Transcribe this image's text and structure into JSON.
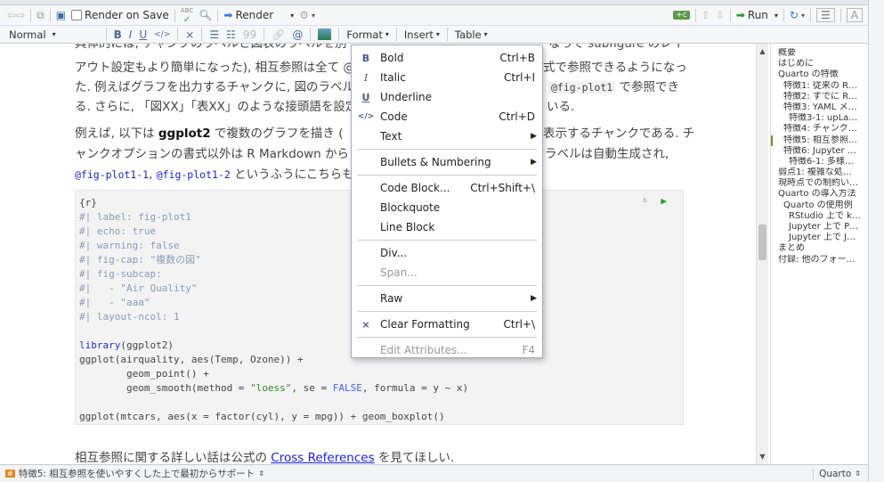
{
  "toolbar": {
    "render_on_save": "Render on Save",
    "render": "Render",
    "run": "Run",
    "spell_icon": "ABC"
  },
  "format_bar": {
    "style": "Normal",
    "format": "Format",
    "insert": "Insert",
    "table": "Table"
  },
  "doc": {
    "p1": [
      {
        "left": "具体的には, チャンクのラベルと図表のラベルを別",
        "right": "なって subfigure のレイ"
      },
      {
        "left": "アウト設定もより簡単になった), 相互参照は全て @",
        "right": "式で参照できるようになっ"
      },
      {
        "left": "た. 例えばグラフを出力するチャンクに, 図のラベル",
        "right_code": "@fig-plot1",
        "right": " で参照でき"
      },
      {
        "left": "る. さらに, 「図XX」「表XX」のような接頭語を設定し",
        "right": "いる."
      }
    ],
    "p2": {
      "l1a": "例えば, 以下は ",
      "l1b": "ggplot2",
      "l1c": " で複数のグラフを描き (",
      "l1r": "表示するチャンクである. チ",
      "l2": "ャンクオプションの書式以外は R Markdown から",
      "l2r": "ラベルは自動生成され,",
      "l3a": "@fig-plot1-1",
      "l3b": ", ",
      "l3c": "@fig-plot1-2",
      "l3d": " というふうにこちらも簡"
    },
    "code": {
      "header": "{r}",
      "options": [
        "#| label: fig-plot1",
        "#| echo: true",
        "#| warning: false",
        "#| fig-cap: \"複数の図\"",
        "#| fig-subcap:",
        "#|   - \"Air Quality\"",
        "#|   - \"aaa\"",
        "#| layout-ncol: 1"
      ],
      "l1a": "library",
      "l1b": "(ggplot2)",
      "l2": "ggplot(airquality, aes(Temp, Ozone)) +",
      "l3": "        geom_point() +",
      "l4a": "        geom_smooth(method = ",
      "l4b": "\"loess\"",
      "l4c": ", se = ",
      "l4d": "FALSE",
      "l4e": ", formula = y ~ x)",
      "l5": "ggplot(mtcars, aes(x = factor(cyl), y = mpg)) + geom_boxplot()"
    },
    "p3a": "相互参照に関する詳しい話は公式の ",
    "p3link": "Cross References",
    "p3b": " を見てほしい."
  },
  "outline": [
    {
      "label": "概要",
      "level": 0
    },
    {
      "label": "はじめに",
      "level": 0
    },
    {
      "label": "Quarto の特徴",
      "level": 0
    },
    {
      "label": "特徴1: 従来の R…",
      "level": 1
    },
    {
      "label": "特徴2: すでに R…",
      "level": 1
    },
    {
      "label": "特徴3: YAML メ…",
      "level": 1
    },
    {
      "label": "特徴3-1: upLa…",
      "level": 2
    },
    {
      "label": "特徴4: チャンク…",
      "level": 1
    },
    {
      "label": "特徴5: 相互参照…",
      "level": 1,
      "active": true
    },
    {
      "label": "特徴6: Jupyter …",
      "level": 1
    },
    {
      "label": "特徴6-1: 多様…",
      "level": 2
    },
    {
      "label": "弱点1: 複雑な処…",
      "level": 0
    },
    {
      "label": "現時点での制約い…",
      "level": 0
    },
    {
      "label": "Quarto の導入方法",
      "level": 0
    },
    {
      "label": "Quarto の使用例",
      "level": 1
    },
    {
      "label": "RStudio 上で k…",
      "level": 2
    },
    {
      "label": "Jupyter 上で P…",
      "level": 2
    },
    {
      "label": "Jupyter 上で J…",
      "level": 2
    },
    {
      "label": "まとめ",
      "level": 0
    },
    {
      "label": "付録: 他のフォー…",
      "level": 0
    }
  ],
  "menu": {
    "items": [
      {
        "label": "Bold",
        "shortcut": "Ctrl+B",
        "icon": "B"
      },
      {
        "label": "Italic",
        "shortcut": "Ctrl+I",
        "icon": "I"
      },
      {
        "label": "Underline",
        "shortcut": "",
        "icon": "U"
      },
      {
        "label": "Code",
        "shortcut": "Ctrl+D",
        "icon": "</>"
      },
      {
        "label": "Text",
        "submenu": true
      },
      {
        "sep": true
      },
      {
        "label": "Bullets & Numbering",
        "submenu": true
      },
      {
        "sep": true
      },
      {
        "label": "Code Block...",
        "shortcut": "Ctrl+Shift+\\"
      },
      {
        "label": "Blockquote"
      },
      {
        "label": "Line Block"
      },
      {
        "sep": true
      },
      {
        "label": "Div..."
      },
      {
        "label": "Span...",
        "disabled": true
      },
      {
        "sep": true
      },
      {
        "label": "Raw",
        "submenu": true
      },
      {
        "sep": true
      },
      {
        "label": "Clear Formatting",
        "shortcut": "Ctrl+\\",
        "icon": "clear"
      },
      {
        "sep": true
      },
      {
        "label": "Edit Attributes...",
        "shortcut": "F4",
        "disabled": true
      }
    ]
  },
  "status": {
    "section": "特徴5: 相互参照を使いやすくした上で最初からサポート",
    "mode": "Quarto"
  }
}
